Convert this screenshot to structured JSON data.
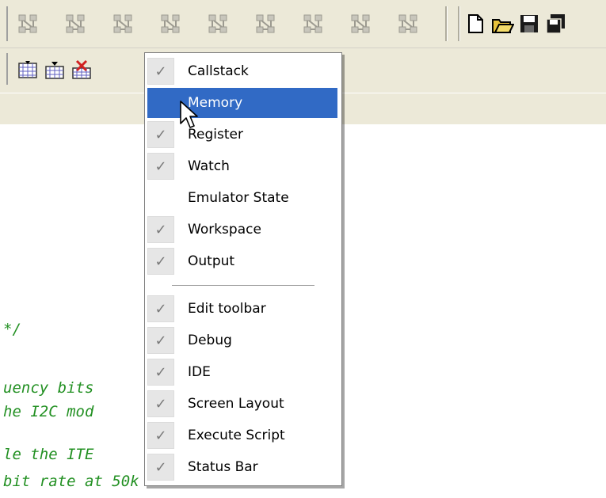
{
  "toolbar": {
    "network_icon_count": 9,
    "file_icons": [
      "new-file-icon",
      "open-folder-icon",
      "save-icon",
      "save-all-icon"
    ],
    "row2_icons": [
      "breakpoint-add-icon",
      "breakpoint-list-icon",
      "breakpoint-delete-icon"
    ]
  },
  "code_fragments": [
    "*/",
    "uency bits",
    "he I2C mod",
    "le the ITE",
    "bit rate at 50k"
  ],
  "menu": {
    "items": [
      {
        "label": "Callstack",
        "checked": true
      },
      {
        "label": "Memory",
        "checked": false,
        "highlighted": true
      },
      {
        "label": "Register",
        "checked": true
      },
      {
        "label": "Watch",
        "checked": true
      },
      {
        "label": "Emulator State",
        "checked": false
      },
      {
        "label": "Workspace",
        "checked": true
      },
      {
        "label": "Output",
        "checked": true
      },
      {
        "label": "Edit toolbar",
        "checked": true
      },
      {
        "label": "Debug",
        "checked": true
      },
      {
        "label": "IDE",
        "checked": true
      },
      {
        "label": "Screen Layout",
        "checked": true
      },
      {
        "label": "Execute Script",
        "checked": true
      },
      {
        "label": "Status Bar",
        "checked": true
      }
    ],
    "check_glyph": "✓"
  },
  "colors": {
    "highlight": "#316ac5",
    "code_comment": "#229022",
    "chrome": "#ece9d8"
  }
}
